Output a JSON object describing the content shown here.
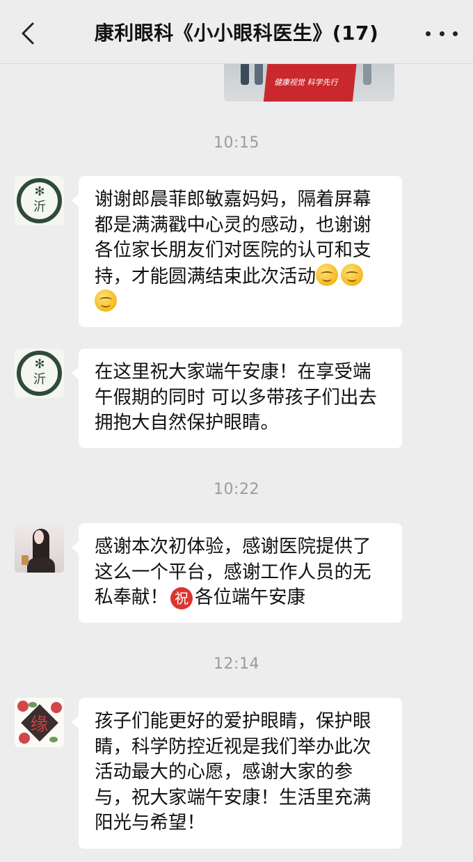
{
  "header": {
    "title": "康利眼科《小小眼科医生》(17)",
    "back_icon": "chevron-left-icon",
    "more_icon": "more-dots-icon"
  },
  "shared_image": {
    "banner_text": "健康视觉 科学先行"
  },
  "timestamps": [
    "10:15",
    "10:22",
    "12:14"
  ],
  "messages": [
    {
      "avatar": "clinic-logo",
      "text": "谢谢郎晨菲郎敏嘉妈妈，隔着屏幕都是满满戳中心灵的感动，也谢谢各位家长朋友们对医院的认可和支持，才能圆满结束此次活动",
      "emoji_icon": "smiling-face-icon",
      "emoji_count": 3
    },
    {
      "avatar": "clinic-logo",
      "text": "在这里祝大家端午安康！在享受端午假期的同时 可以多带孩子们出去拥抱大自然保护眼睛。"
    },
    {
      "avatar": "girl-photo",
      "text_before": "感谢本次初体验，感谢医院提供了这么一个平台，感谢工作人员的无私奉献！",
      "blessing_char": "祝",
      "text_after": "各位端午安康"
    },
    {
      "avatar": "flower-badge",
      "avatar_glyph": "缘",
      "text": "孩子们能更好的爱护眼睛，保护眼睛，科学防控近视是我们举办此次活动最大的心愿，感谢大家的参与，祝大家端午安康！生活里充满阳光与希望！"
    }
  ],
  "colors": {
    "background": "#ededed",
    "bubble": "#ffffff",
    "timestamp": "#9b9b9b",
    "blessing_badge": "#d9362f"
  }
}
